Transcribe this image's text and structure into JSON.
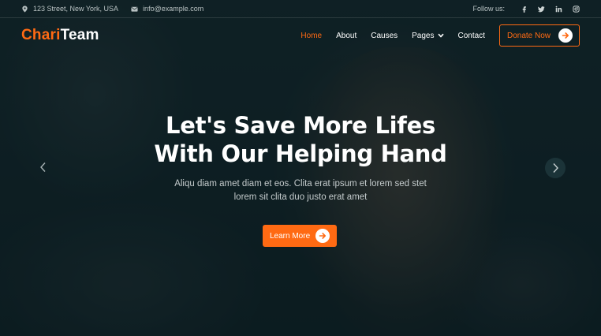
{
  "topbar": {
    "address": "123 Street, New York, USA",
    "email": "info@example.com",
    "follow_label": "Follow us:",
    "icons": [
      "map-pin-icon",
      "envelope-icon",
      "facebook-icon",
      "twitter-icon",
      "linkedin-icon",
      "instagram-icon"
    ]
  },
  "brand": {
    "part1": "Chari",
    "part2": "Team",
    "accent_color": "#ff6a13"
  },
  "nav": {
    "items": [
      {
        "label": "Home"
      },
      {
        "label": "About"
      },
      {
        "label": "Causes"
      },
      {
        "label": "Pages"
      },
      {
        "label": "Contact"
      }
    ],
    "donate_label": "Donate Now"
  },
  "hero": {
    "headline_line1": "Let's Save More Lifes",
    "headline_line2": "With Our Helping Hand",
    "sub_line1": "Aliqu diam amet diam et eos. Clita erat ipsum et lorem sed stet",
    "sub_line2": "lorem sit clita duo justo erat amet",
    "cta_label": "Learn More"
  }
}
